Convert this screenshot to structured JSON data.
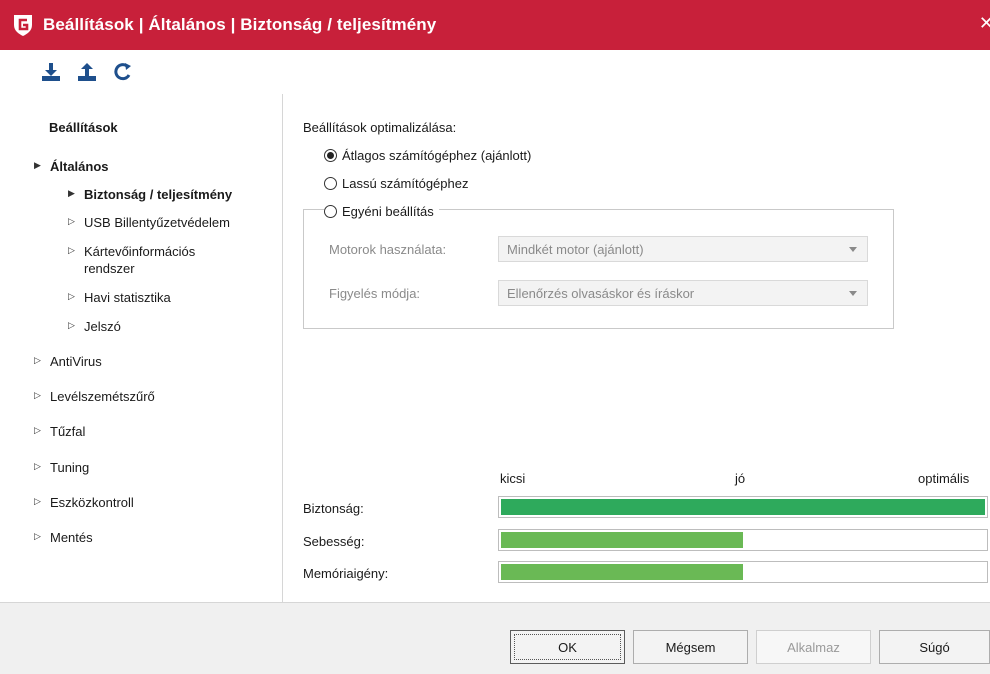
{
  "window": {
    "title": "Beállítások | Általános | Biztonság / teljesítmény",
    "accent_color": "#c8203a",
    "logo_icon": "gdata-shield-icon",
    "close_icon": "close-icon",
    "close_glyph": "✕"
  },
  "toolbar": {
    "buttons": [
      {
        "icon": "import-icon",
        "name": "import-button"
      },
      {
        "icon": "export-icon",
        "name": "export-button"
      },
      {
        "icon": "reset-icon",
        "name": "reset-button"
      }
    ]
  },
  "sidebar": {
    "header": "Beállítások",
    "items": [
      {
        "label": "Általános",
        "expanded": true,
        "bold": true
      },
      {
        "label": "Biztonság / teljesítmény",
        "expanded": true,
        "bold": true,
        "selected": true
      },
      {
        "label": "USB Billentyűzetvédelem"
      },
      {
        "label": "Kártevőinformációs rendszer"
      },
      {
        "label": "Havi statisztika"
      },
      {
        "label": "Jelszó"
      },
      {
        "label": "AntiVirus"
      },
      {
        "label": "Levélszemétszűrő"
      },
      {
        "label": "Tűzfal"
      },
      {
        "label": "Tuning"
      },
      {
        "label": "Eszközkontroll"
      },
      {
        "label": "Mentés"
      }
    ]
  },
  "main": {
    "section_title": "Beállítások optimalizálása:",
    "options": [
      {
        "label": "Átlagos számítógéphez (ajánlott)",
        "checked": true
      },
      {
        "label": "Lassú számítógéphez",
        "checked": false
      },
      {
        "label": "Egyéni beállítás",
        "checked": false
      }
    ],
    "custom": {
      "engines_label": "Motorok használata:",
      "engines_value": "Mindkét motor (ajánlott)",
      "monitor_label": "Figyelés módja:",
      "monitor_value": "Ellenőrzés olvasáskor és íráskor"
    },
    "scale": {
      "low": "kicsi",
      "mid": "jó",
      "high": "optimális"
    },
    "bars": [
      {
        "label": "Biztonság:",
        "level": 1.0,
        "color": "#2eaa5c"
      },
      {
        "label": "Sebesség:",
        "level": 0.5,
        "color": "#6ab955"
      },
      {
        "label": "Memóriaigény:",
        "level": 0.5,
        "color": "#6ab955"
      }
    ]
  },
  "footer": {
    "ok": "OK",
    "cancel": "Mégsem",
    "apply": "Alkalmaz",
    "help": "Súgó"
  }
}
